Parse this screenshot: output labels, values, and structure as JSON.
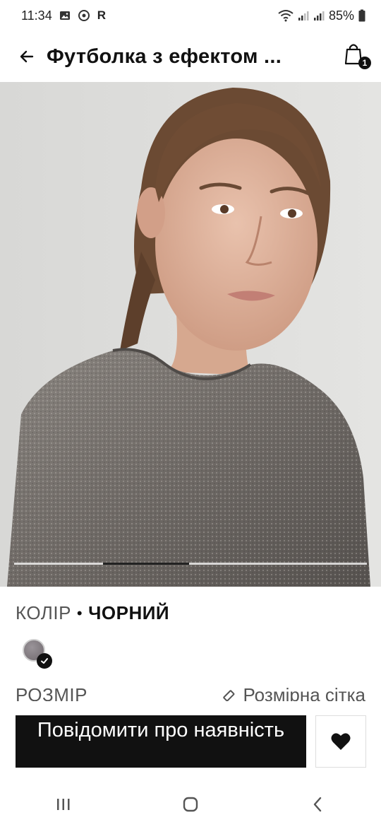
{
  "status_bar": {
    "time": "11:34",
    "carrier_letter": "R",
    "battery": "85%"
  },
  "header": {
    "title": "Футболка з ефектом ...",
    "cart_count": "1"
  },
  "gallery": {
    "active_index": 1,
    "total": 4
  },
  "color": {
    "label": "КОЛІР",
    "separator": "•",
    "value": "ЧОРНИЙ",
    "swatch_color": "#7d777b"
  },
  "size": {
    "label": "РОЗМІР",
    "guide_label": "Розмірна сітка"
  },
  "actions": {
    "notify_label": "Повідомити про наявність"
  }
}
